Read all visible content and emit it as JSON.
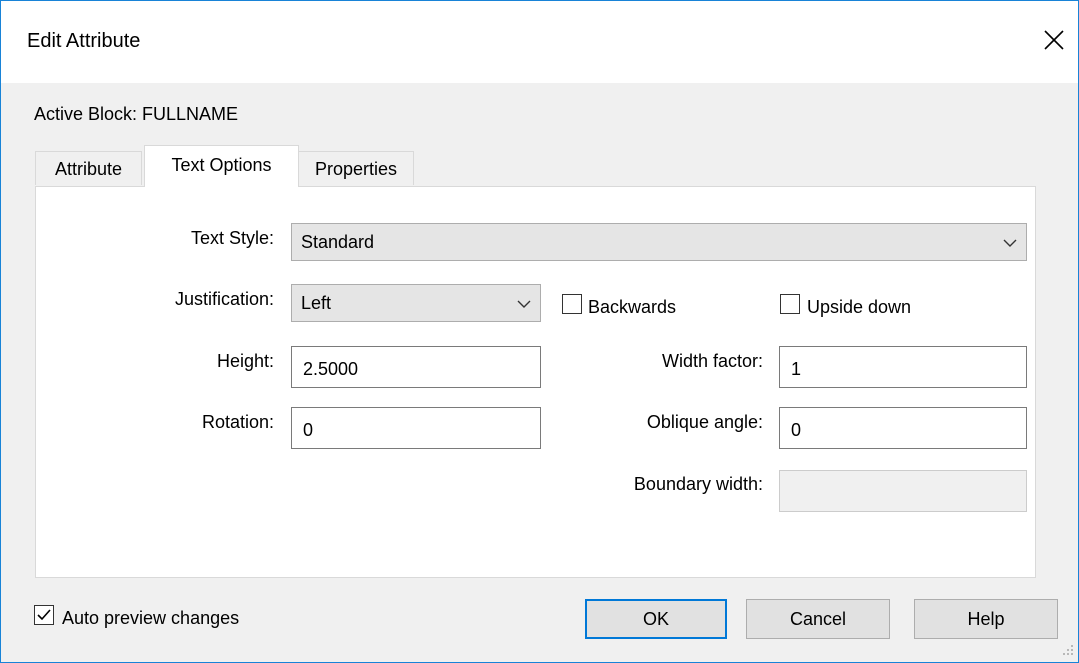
{
  "window": {
    "title": "Edit Attribute",
    "close_icon": "close-icon"
  },
  "active_block": "Active Block: FULLNAME",
  "tabs": [
    {
      "label": "Attribute",
      "active": false
    },
    {
      "label": "Text Options",
      "active": true
    },
    {
      "label": "Properties",
      "active": false
    }
  ],
  "text_options": {
    "text_style": {
      "label": "Text Style:",
      "value": "Standard"
    },
    "justification": {
      "label": "Justification:",
      "value": "Left"
    },
    "backwards": {
      "label": "Backwards",
      "checked": false
    },
    "upside_down": {
      "label": "Upside down",
      "checked": false
    },
    "height": {
      "label": "Height:",
      "value": "2.5000"
    },
    "width_factor": {
      "label": "Width factor:",
      "value": "1"
    },
    "rotation": {
      "label": "Rotation:",
      "value": "0"
    },
    "oblique_angle": {
      "label": "Oblique angle:",
      "value": "0"
    },
    "boundary_width": {
      "label": "Boundary width:",
      "value": "",
      "enabled": false
    }
  },
  "auto_preview": {
    "label": "Auto preview changes",
    "checked": true
  },
  "buttons": {
    "ok": "OK",
    "cancel": "Cancel",
    "help": "Help"
  },
  "colors": {
    "accent": "#0078d7",
    "window_border": "#1883d7",
    "dialog_bg": "#f0f0f0"
  }
}
